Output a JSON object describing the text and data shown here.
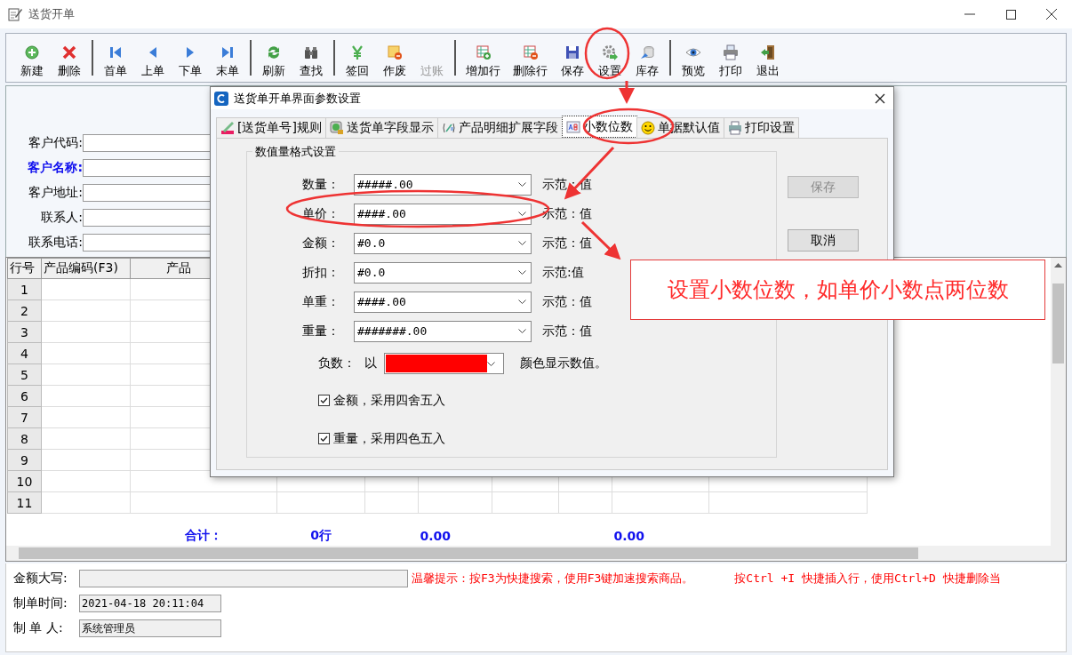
{
  "window": {
    "title": "送货开单"
  },
  "toolbar": {
    "groups": [
      [
        {
          "label": "新建",
          "disabled": false
        },
        {
          "label": "删除",
          "disabled": false
        }
      ],
      [
        {
          "label": "首单",
          "disabled": false
        },
        {
          "label": "上单",
          "disabled": false
        },
        {
          "label": "下单",
          "disabled": false
        },
        {
          "label": "末单",
          "disabled": false
        }
      ],
      [
        {
          "label": "刷新",
          "disabled": false
        },
        {
          "label": "查找",
          "disabled": false
        }
      ],
      [
        {
          "label": "签回",
          "disabled": false
        },
        {
          "label": "作废",
          "disabled": false
        },
        {
          "label": "过账",
          "disabled": true
        }
      ],
      [
        {
          "label": "增加行",
          "disabled": false
        },
        {
          "label": "删除行",
          "disabled": false
        },
        {
          "label": "保存",
          "disabled": false
        },
        {
          "label": "设置",
          "disabled": false
        },
        {
          "label": "库存",
          "disabled": false
        }
      ],
      [
        {
          "label": "预览",
          "disabled": false
        },
        {
          "label": "打印",
          "disabled": false
        },
        {
          "label": "退出",
          "disabled": false
        }
      ]
    ]
  },
  "customer_form": [
    {
      "label": "客户代码:",
      "required": false
    },
    {
      "label": "客户名称:",
      "required": true
    },
    {
      "label": "客户地址:",
      "required": false
    },
    {
      "label": "联系人:",
      "required": false
    },
    {
      "label": "联系电话:",
      "required": false
    }
  ],
  "table": {
    "columns": [
      "行号",
      "产品编码(F3)",
      "产品"
    ],
    "rows": [
      "1",
      "2",
      "3",
      "4",
      "5",
      "6",
      "7",
      "8",
      "9",
      "10",
      "11"
    ],
    "totals": {
      "column_3": "合计：",
      "column_4": "0行",
      "column_6": "0.00",
      "column_9": "0.00"
    }
  },
  "footer": {
    "amount_words_label": "金额大写:",
    "hints": [
      "温馨提示：按F3为快捷搜索，使用F3键加速搜索商品。",
      "按Ctrl +I 快捷插入行，使用Ctrl+D 快捷删除当"
    ],
    "created_time_label": "制单时间:",
    "created_time": "2021-04-18 20:11:04",
    "creator_label": "制 单 人:",
    "creator": "系统管理员"
  },
  "dialog": {
    "title": "送货单开单界面参数设置",
    "tabs": [
      {
        "label": "[送货单号]规则",
        "selected": false
      },
      {
        "label": "送货单字段显示",
        "selected": false
      },
      {
        "label": "产品明细扩展字段",
        "selected": false
      },
      {
        "label": "小数位数",
        "selected": true
      },
      {
        "label": "单据默认值",
        "selected": false
      },
      {
        "label": "打印设置",
        "selected": false
      }
    ],
    "group_title": "数值量格式设置",
    "formats": [
      {
        "label": "数量：",
        "value": "#####.00",
        "demo": "示范：值"
      },
      {
        "label": "单价：",
        "value": "####.00",
        "demo": "示范：值"
      },
      {
        "label": "金额：",
        "value": "#0.0",
        "demo": "示范：值"
      },
      {
        "label": "折扣：",
        "value": "#0.0",
        "demo": "示范:值"
      },
      {
        "label": "单重：",
        "value": "####.00",
        "demo": "示范：值"
      },
      {
        "label": "重量：",
        "value": "#######.00",
        "demo": "示范：值"
      }
    ],
    "negative": {
      "label": "负数：",
      "prefix": "以",
      "color": "#ff0000",
      "suffix": "颜色显示数值。"
    },
    "options": [
      {
        "label": "金额，采用四舍五入",
        "checked": true
      },
      {
        "label": "重量，采用四色五入",
        "checked": true
      }
    ],
    "buttons": [
      {
        "label": "保存",
        "disabled": true
      },
      {
        "label": "取消",
        "disabled": false
      }
    ]
  },
  "annotation": {
    "callout": "设置小数位数，如单价小数点两位数"
  }
}
